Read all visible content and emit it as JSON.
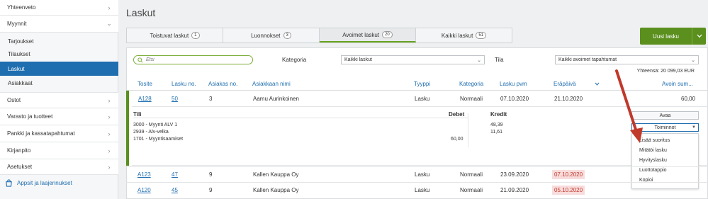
{
  "sidebar": {
    "items": [
      {
        "label": "Yhteenveto",
        "chevron": "right"
      },
      {
        "label": "Myynnit",
        "chevron": "down"
      },
      {
        "label": "Ostot",
        "chevron": "right"
      },
      {
        "label": "Varasto ja tuotteet",
        "chevron": "right"
      },
      {
        "label": "Pankki ja kassatapahtumat",
        "chevron": "right"
      },
      {
        "label": "Kirjanpito",
        "chevron": "right"
      },
      {
        "label": "Asetukset",
        "chevron": "right"
      }
    ],
    "sub_items": [
      {
        "label": "Tarjoukset"
      },
      {
        "label": "Tilaukset"
      },
      {
        "label": "Laskut",
        "active": true
      },
      {
        "label": "Asiakkaat"
      }
    ],
    "apps_label": "Appsit ja laajennukset"
  },
  "page": {
    "title": "Laskut"
  },
  "tabs": [
    {
      "label": "Toistuvat laskut",
      "count": "1"
    },
    {
      "label": "Luonnokset",
      "count": "3"
    },
    {
      "label": "Avoimet laskut",
      "count": "20",
      "active": true
    },
    {
      "label": "Kaikki laskut",
      "count": "51"
    }
  ],
  "new_button": {
    "label": "Uusi lasku"
  },
  "filters": {
    "search_placeholder": "Etsi",
    "kategoria_label": "Kategoria",
    "kategoria_value": "Kaikki laskut",
    "tila_label": "Tila",
    "tila_value": "Kaikki avoimet tapahtumat"
  },
  "total": "Yhteensä: 20 099,03 EUR",
  "columns": [
    "Tosite",
    "Lasku no.",
    "Asiakas no.",
    "Asiakkaan nimi",
    "Tyyppi",
    "Kategoria",
    "Lasku pvm",
    "Eräpäivä",
    "Avoin sum..."
  ],
  "rows": [
    {
      "tosite": "A128",
      "lasku_no": "50",
      "asiakas_no": "3",
      "nimi": "Aamu Aurinkoinen",
      "tyyppi": "Lasku",
      "kategoria": "Normaali",
      "lasku_pvm": "07.10.2020",
      "erapaiva": "21.10.2020",
      "overdue": false,
      "avoin": "60,00"
    },
    {
      "tosite": "A123",
      "lasku_no": "47",
      "asiakas_no": "9",
      "nimi": "Kallen Kauppa Oy",
      "tyyppi": "Lasku",
      "kategoria": "Normaali",
      "lasku_pvm": "23.09.2020",
      "erapaiva": "07.10.2020",
      "overdue": true,
      "avoin": ""
    },
    {
      "tosite": "A120",
      "lasku_no": "45",
      "asiakas_no": "9",
      "nimi": "Kallen Kauppa Oy",
      "tyyppi": "Lasku",
      "kategoria": "Normaali",
      "lasku_pvm": "21.09.2020",
      "erapaiva": "05.10.2020",
      "overdue": true,
      "avoin": ""
    }
  ],
  "detail": {
    "tili_label": "Tili",
    "debet_label": "Debet",
    "kredit_label": "Kredit",
    "accounts": [
      "3000 - Myynti ALV 1",
      "2939 - Alv-velka",
      "1701 - Myyntisaamiset"
    ],
    "debet": [
      "",
      "",
      "60,00"
    ],
    "kredit": [
      "48,39",
      "11,61",
      ""
    ]
  },
  "actions": {
    "avaa_label": "Avaa",
    "toiminnot_label": "Toiminnot",
    "menu": [
      "Lisää suoritus",
      "Mitätöi lasku",
      "Hyvityslasku",
      "Luottotappio",
      "Kopioi"
    ]
  },
  "colors": {
    "accent_green": "#5b8f1e",
    "active_blue": "#1f6eb0",
    "overdue_bg": "#f8dcdc",
    "annotation_arrow": "#c0392b"
  }
}
